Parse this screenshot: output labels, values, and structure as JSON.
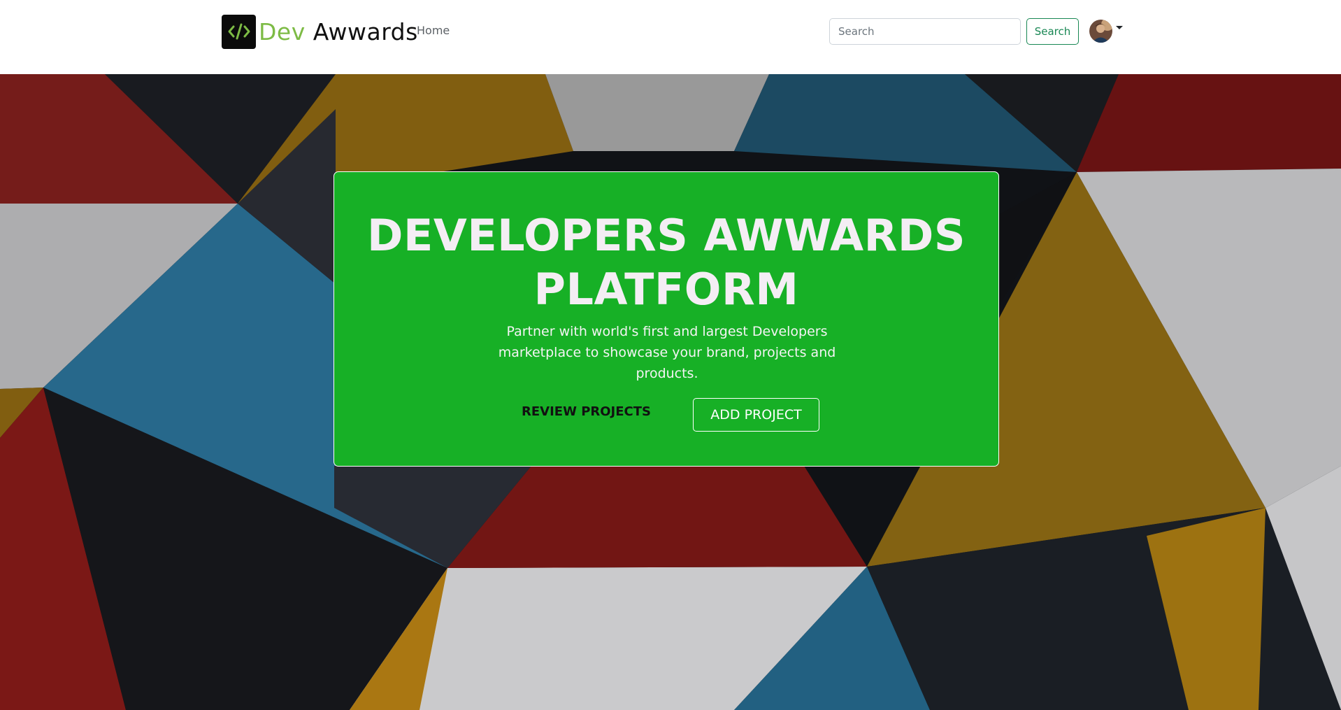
{
  "navbar": {
    "brand_prefix": "Dev",
    "brand_suffix": "Awwards",
    "home_link": "Home",
    "search_placeholder": "Search",
    "search_button": "Search"
  },
  "hero": {
    "title": "DEVELOPERS AWWARDS PLATFORM",
    "subtitle": "Partner with world's first and largest Developers marketplace to showcase your brand, projects and products.",
    "review_button": "REVIEW PROJECTS",
    "add_button": "ADD PROJECT"
  },
  "icons": {
    "logo": "code-brackets-icon",
    "avatar": "user-avatar",
    "dropdown": "caret-down-icon"
  },
  "colors": {
    "brand_green": "#7dbb45",
    "hero_card": "#17b026",
    "search_accent": "#198754"
  }
}
